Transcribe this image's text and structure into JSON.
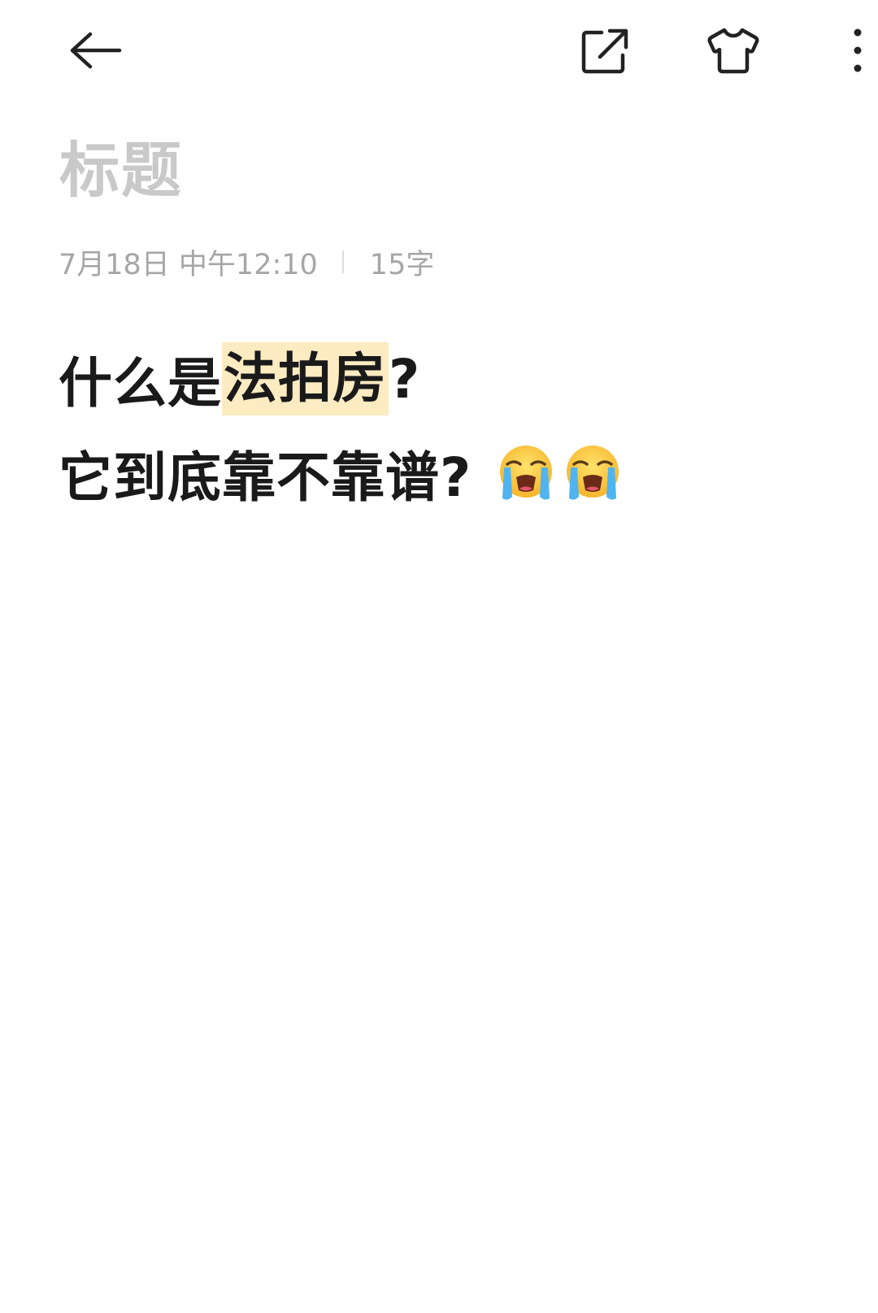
{
  "toolbar": {
    "back_icon": "arrow-left-icon",
    "share_icon": "share-external-icon",
    "theme_icon": "tshirt-skin-icon",
    "more_icon": "more-vertical-icon"
  },
  "note": {
    "title_placeholder": "标题",
    "date": "7月18日 中午12:10",
    "word_count": "15字",
    "line1_prefix": "什么是",
    "line1_highlight": "法拍房",
    "line1_suffix": "?",
    "line2_text": "它到底靠不靠谱?",
    "line2_emoji": "loudly-crying-face-icon",
    "highlight_color": "#fdebc2"
  }
}
